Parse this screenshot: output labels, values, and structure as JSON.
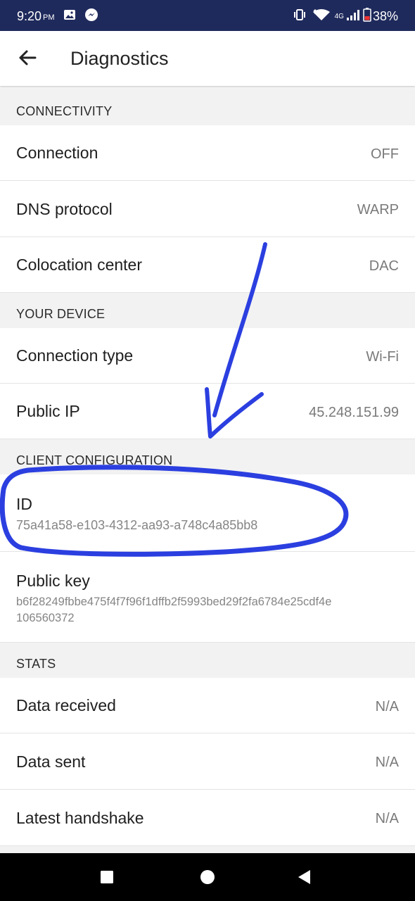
{
  "status_bar": {
    "time": "9:20",
    "ampm": "PM",
    "network": "4G",
    "battery": "38%"
  },
  "appbar": {
    "title": "Diagnostics",
    "back_icon": "arrow-back-icon"
  },
  "sections": {
    "connectivity": {
      "header": "CONNECTIVITY",
      "connection": {
        "label": "Connection",
        "value": "OFF"
      },
      "dns_protocol": {
        "label": "DNS protocol",
        "value": "WARP"
      },
      "colocation_center": {
        "label": "Colocation center",
        "value": "DAC"
      }
    },
    "your_device": {
      "header": "YOUR DEVICE",
      "connection_type": {
        "label": "Connection type",
        "value": "Wi-Fi"
      },
      "public_ip": {
        "label": "Public IP",
        "value": "45.248.151.99"
      }
    },
    "client_configuration": {
      "header": "CLIENT CONFIGURATION",
      "id": {
        "label": "ID",
        "value": "75a41a58-e103-4312-aa93-a748c4a85bb8"
      },
      "public_key": {
        "label": "Public key",
        "value_line1": "b6f28249fbbe475f4f7f96f1dffb2f5993bed29f2fa6784e25cdf4e",
        "value_line2": "106560372"
      }
    },
    "stats": {
      "header": "STATS",
      "data_received": {
        "label": "Data received",
        "value": "N/A"
      },
      "data_sent": {
        "label": "Data sent",
        "value": "N/A"
      },
      "latest_handshake": {
        "label": "Latest handshake",
        "value": "N/A"
      }
    }
  },
  "colors": {
    "status_bar": "#1f2a5c",
    "annotation": "#2b3fe0",
    "background": "#f2f2f2"
  }
}
